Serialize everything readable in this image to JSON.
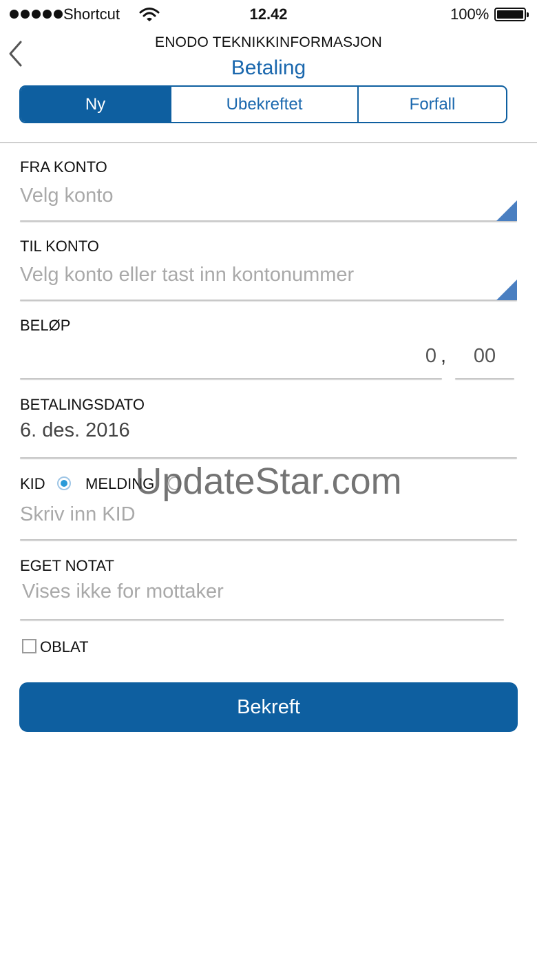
{
  "status_bar": {
    "carrier": "Shortcut",
    "time": "12.42",
    "battery_percent": "100%"
  },
  "nav": {
    "app_title": "ENODO TEKNIKKINFORMASJON",
    "page_title": "Betaling"
  },
  "tabs": [
    {
      "label": "Ny",
      "active": true
    },
    {
      "label": "Ubekreftet",
      "active": false
    },
    {
      "label": "Forfall",
      "active": false
    }
  ],
  "form": {
    "fra_konto": {
      "label": "FRA KONTO",
      "placeholder": "Velg konto"
    },
    "til_konto": {
      "label": "TIL KONTO",
      "placeholder": "Velg konto eller tast inn kontonummer"
    },
    "belop": {
      "label": "BELØP",
      "whole": "0",
      "separator": ",",
      "decimals": "00"
    },
    "betalingsdato": {
      "label": "BETALINGSDATO",
      "value": "6. des. 2016"
    },
    "reference": {
      "kid_label": "KID",
      "melding_label": "MELDING",
      "selected": "KID",
      "placeholder": "Skriv inn KID"
    },
    "eget_notat": {
      "label": "EGET NOTAT",
      "placeholder": "Vises ikke for mottaker"
    },
    "oblat": {
      "label": "OBLAT",
      "checked": false
    }
  },
  "confirm_button": {
    "label": "Bekreft"
  },
  "watermark": "UpdateStar.com",
  "colors": {
    "brand": "#0e5fa0",
    "accent_text": "#1b68ae",
    "placeholder": "#a9a9a9",
    "dropdown_triangle": "#4a7fc1",
    "radio_selected": "#2b9ad8"
  },
  "icons": {
    "back": "chevron-left-icon",
    "wifi": "wifi-icon",
    "battery": "battery-icon",
    "dropdown": "dropdown-triangle-icon"
  }
}
